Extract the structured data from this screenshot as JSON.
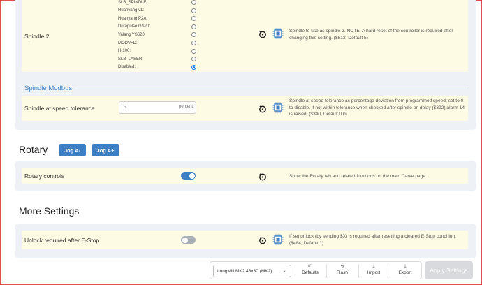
{
  "spindle2": {
    "label": "Spindle 2",
    "options": [
      "SLB_SPINDLE:",
      "Huanyang v1:",
      "Huanyang P2A:",
      "Durapulse GS20:",
      "Yalang YS620:",
      "MODVFD:",
      "H-100:",
      "SLB_LASER:",
      "Disabled:"
    ],
    "selected": "Disabled:",
    "description": "Spindle to use as spindle 2. NOTE: A hard reset of the controller is required after changing this setting. ($512, Default 5)"
  },
  "spindle_modbus": {
    "title": "Spindle Modbus",
    "label": "Spindle at speed tolerance",
    "value": "5",
    "unit": "percent",
    "description": "Spindle at speed tolerance as percentage deviation from programmed speed, set to 0 to disable. If not within tolerance when checked after spindle on delay ($392) alarm 14 is raised. ($340, Default 0.0)"
  },
  "rotary": {
    "title": "Rotary",
    "jog_minus": "Jog A-",
    "jog_plus": "Jog A+",
    "controls_label": "Rotary controls",
    "controls_on": true,
    "controls_description": "Show the Rotary tab and related functions on the main Carve page."
  },
  "more_settings": {
    "title": "More Settings",
    "unlock_label": "Unlock required after E-Stop",
    "unlock_on": false,
    "unlock_description": "If set unlock (by sending $X) is required after resetting a cleared E-Stop condition. ($484, Default 1)"
  },
  "toolbar": {
    "machine": "LongMill MK2 48x30 (MK2)",
    "defaults": "Defaults",
    "flash": "Flash",
    "import": "Import",
    "export": "Export",
    "apply": "Apply Settings"
  },
  "colors": {
    "accent": "#3d7fc4",
    "row_bg": "#fdfbe3",
    "card_bg": "#eef1f5"
  }
}
